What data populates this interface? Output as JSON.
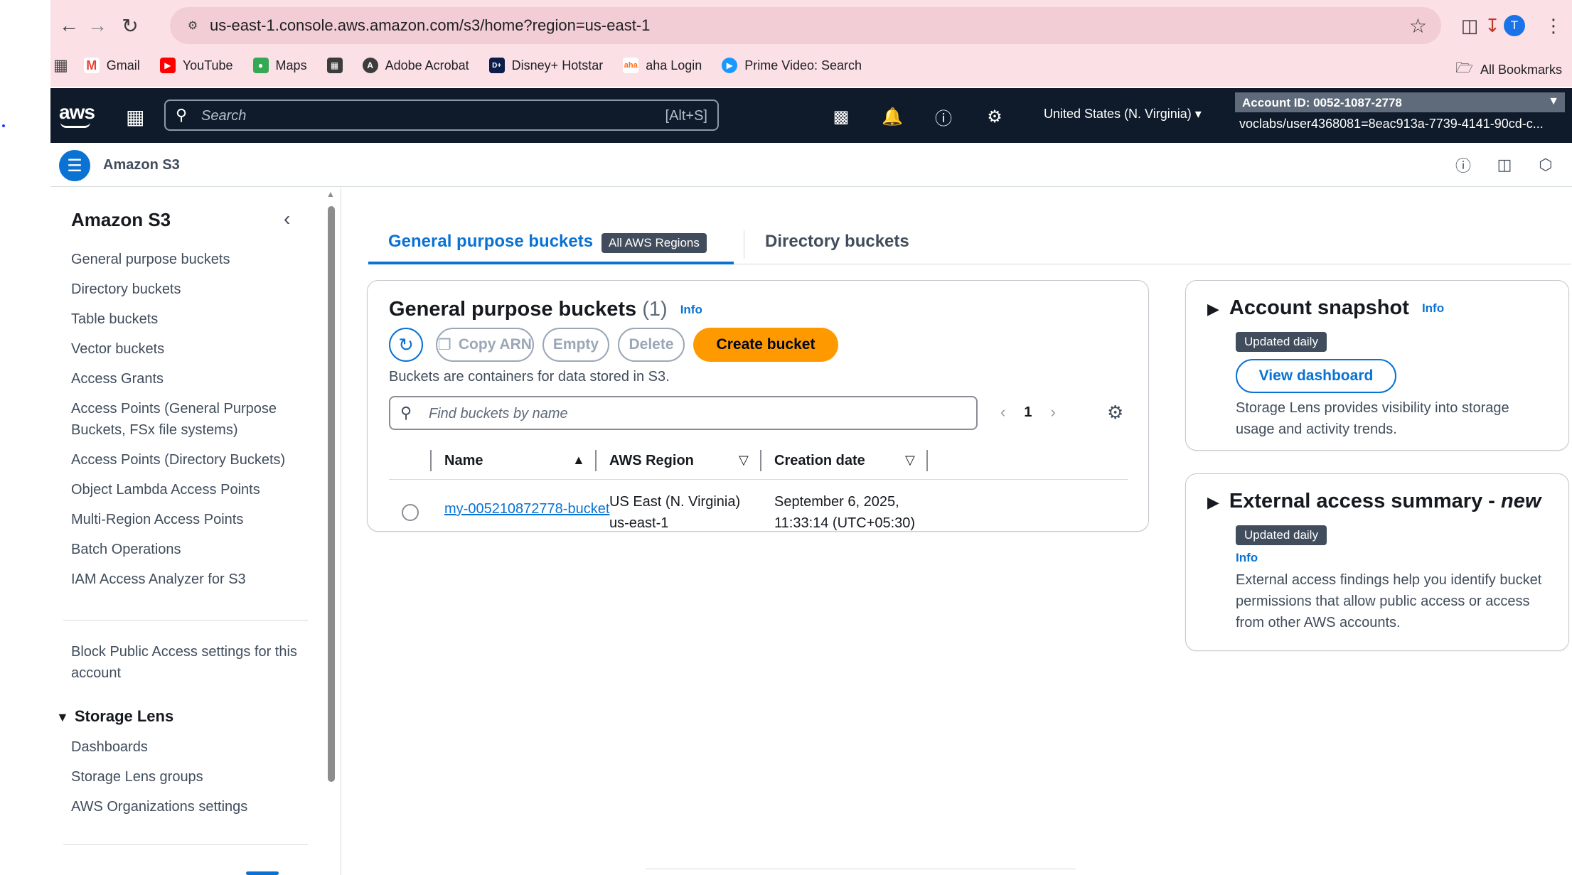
{
  "browser": {
    "url": "us-east-1.console.aws.amazon.com/s3/home?region=us-east-1",
    "avatar_letter": "T",
    "bookmarks": [
      {
        "label": "Gmail",
        "icon": "gmail-icon",
        "color": "#ea4335"
      },
      {
        "label": "YouTube",
        "icon": "youtube-icon",
        "color": "#ff0000"
      },
      {
        "label": "Maps",
        "icon": "maps-icon",
        "color": "#34a853"
      },
      {
        "label": "",
        "icon": "bookmark-page-icon",
        "color": "#3c3c3c"
      },
      {
        "label": "Adobe Acrobat",
        "icon": "acrobat-icon",
        "color": "#3c3c3c"
      },
      {
        "label": "Disney+ Hotstar",
        "icon": "hotstar-icon",
        "color": "#0b1d4a"
      },
      {
        "label": "aha Login",
        "icon": "aha-icon",
        "color": "#ff6a13"
      },
      {
        "label": "Prime Video: Search",
        "icon": "prime-video-icon",
        "color": "#1a98ff"
      }
    ],
    "all_bookmarks": "All Bookmarks"
  },
  "aws_header": {
    "logo": "aws",
    "search_placeholder": "Search",
    "search_shortcut": "[Alt+S]",
    "region": "United States (N. Virginia)",
    "account": "Account ID: 0052-1087-2778",
    "user": "voclabs/user4368081=8eac913a-7739-4141-90cd-c..."
  },
  "service_bar": {
    "name": "Amazon S3"
  },
  "sidenav": {
    "title": "Amazon S3",
    "items": [
      "General purpose buckets",
      "Directory buckets",
      "Table buckets",
      "Vector buckets",
      "Access Grants",
      "Access Points (General Purpose Buckets, FSx file systems)",
      "Access Points (Directory Buckets)",
      "Object Lambda Access Points",
      "Multi-Region Access Points",
      "Batch Operations",
      "IAM Access Analyzer for S3"
    ],
    "block_public": "Block Public Access settings for this account",
    "storage_lens_title": "Storage Lens",
    "storage_lens_items": [
      "Dashboards",
      "Storage Lens groups",
      "AWS Organizations settings"
    ]
  },
  "tabs": {
    "active": "General purpose buckets",
    "active_badge": "All AWS Regions",
    "second": "Directory buckets"
  },
  "buckets_panel": {
    "title": "General purpose buckets",
    "count": "(1)",
    "info": "Info",
    "buttons": {
      "copy_arn": "Copy ARN",
      "empty": "Empty",
      "delete": "Delete",
      "create": "Create bucket"
    },
    "description": "Buckets are containers for data stored in S3.",
    "search_placeholder": "Find buckets by name",
    "page": "1",
    "columns": [
      "Name",
      "AWS Region",
      "Creation date"
    ],
    "rows": [
      {
        "name": "my-005210872778-bucket",
        "region": "US East (N. Virginia) us-east-1",
        "created": "September 6, 2025, 11:33:14 (UTC+05:30)"
      }
    ]
  },
  "snapshot": {
    "title": "Account snapshot",
    "info": "Info",
    "badge": "Updated daily",
    "button": "View dashboard",
    "text": "Storage Lens provides visibility into storage usage and activity trends."
  },
  "external": {
    "title": "External access summary - ",
    "title_new": "new",
    "badge": "Updated daily",
    "info": "Info",
    "text": "External access findings help you identify bucket permissions that allow public access or access from other AWS accounts."
  },
  "colors": {
    "accent": "#0972d3",
    "create_button": "#ff9900",
    "header_bg": "#0f1b2a",
    "browser_bg": "#fbe0e6"
  }
}
